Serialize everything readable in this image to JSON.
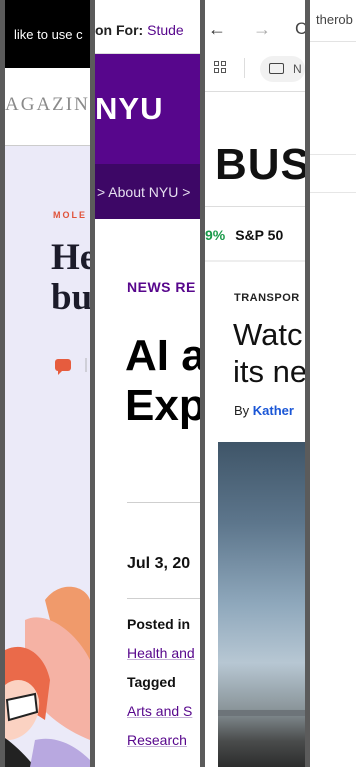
{
  "strip1": {
    "banner_text": "like to use c",
    "masthead": "AGAZIN",
    "kicker": "MOLE",
    "headline_line1": "He",
    "headline_line2": "bu",
    "colors": {
      "background": "#ebeaf8",
      "accent": "#e0533a"
    }
  },
  "strip2": {
    "bar_label": "on For:",
    "bar_link": "Stude",
    "logo": "NYU",
    "breadcrumb": "> About NYU >",
    "kicker": "NEWS RE",
    "title_line1": "AI a",
    "title_line2": "Exp",
    "date": "Jul 3, 20",
    "posted_in_label": "Posted in",
    "posted_in_value": "Health and",
    "tagged_label": "Tagged",
    "tag1": "Arts and S",
    "tag2": "Research",
    "colors": {
      "brand": "#57068c",
      "dark": "#3d0766"
    }
  },
  "strip3": {
    "nav_back": "←",
    "nav_forward": "→",
    "nav_partial": "C",
    "bookmark_folder_label": "N",
    "brand": "BUS",
    "ticker_change": "9%",
    "ticker_name": "S&P 50",
    "category": "TRANSPOR",
    "headline_line1": "Watc",
    "headline_line2": "its ne",
    "byline_prefix": "By ",
    "byline_author": "Kather",
    "colors": {
      "positive": "#1a9a4a",
      "link": "#1a56d6"
    }
  },
  "strip4": {
    "tab_title": "therob"
  }
}
